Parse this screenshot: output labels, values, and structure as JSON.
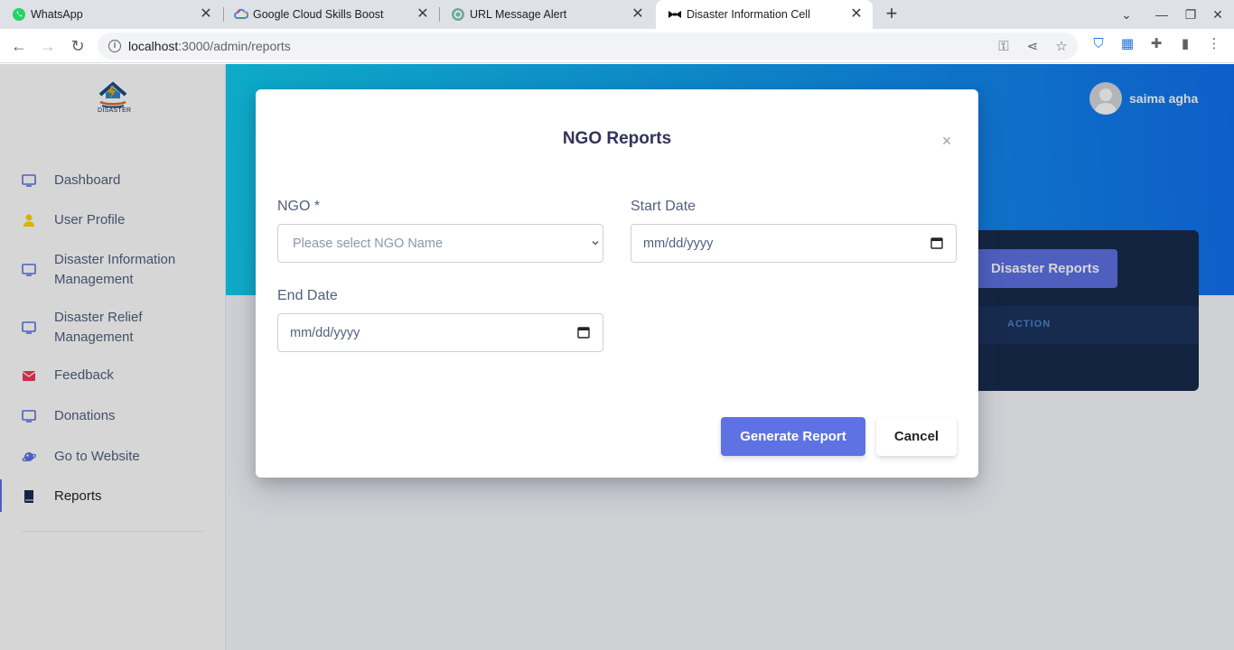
{
  "browser": {
    "tabs": [
      {
        "title": "WhatsApp",
        "icon": "whatsapp-icon"
      },
      {
        "title": "Google Cloud Skills Boost",
        "icon": "google-cloud-icon"
      },
      {
        "title": "URL Message Alert",
        "icon": "chatgpt-icon"
      },
      {
        "title": "Disaster Information Cell",
        "icon": "bowtie-icon",
        "active": true
      }
    ],
    "url_host": "localhost",
    "url_path": ":3000/admin/reports"
  },
  "sidebar": {
    "logo_text": "DISASTER",
    "items": [
      {
        "label": "Dashboard",
        "icon": "monitor-icon"
      },
      {
        "label": "User Profile",
        "icon": "user-icon"
      },
      {
        "label": "Disaster Information Management",
        "icon": "monitor-icon"
      },
      {
        "label": "Disaster Relief Management",
        "icon": "monitor-icon"
      },
      {
        "label": "Feedback",
        "icon": "envelope-icon"
      },
      {
        "label": "Donations",
        "icon": "monitor-icon"
      },
      {
        "label": "Go to Website",
        "icon": "planet-icon"
      },
      {
        "label": "Reports",
        "icon": "book-icon",
        "active": true
      }
    ]
  },
  "header": {
    "username": "saima agha"
  },
  "card": {
    "button_label": "Disaster Reports",
    "column_action": "ACTION"
  },
  "modal": {
    "title": "NGO Reports",
    "close": "×",
    "ngo_label": "NGO *",
    "ngo_placeholder": "Please select NGO Name",
    "start_label": "Start Date",
    "start_placeholder": "mm/dd/yyyy",
    "end_label": "End Date",
    "end_placeholder": "mm/dd/yyyy",
    "generate_label": "Generate Report",
    "cancel_label": "Cancel"
  },
  "colors": {
    "primary": "#5e72e4",
    "header_gradient_start": "#11cdef",
    "header_gradient_end": "#1171ef",
    "card_dark": "#172b4d"
  }
}
